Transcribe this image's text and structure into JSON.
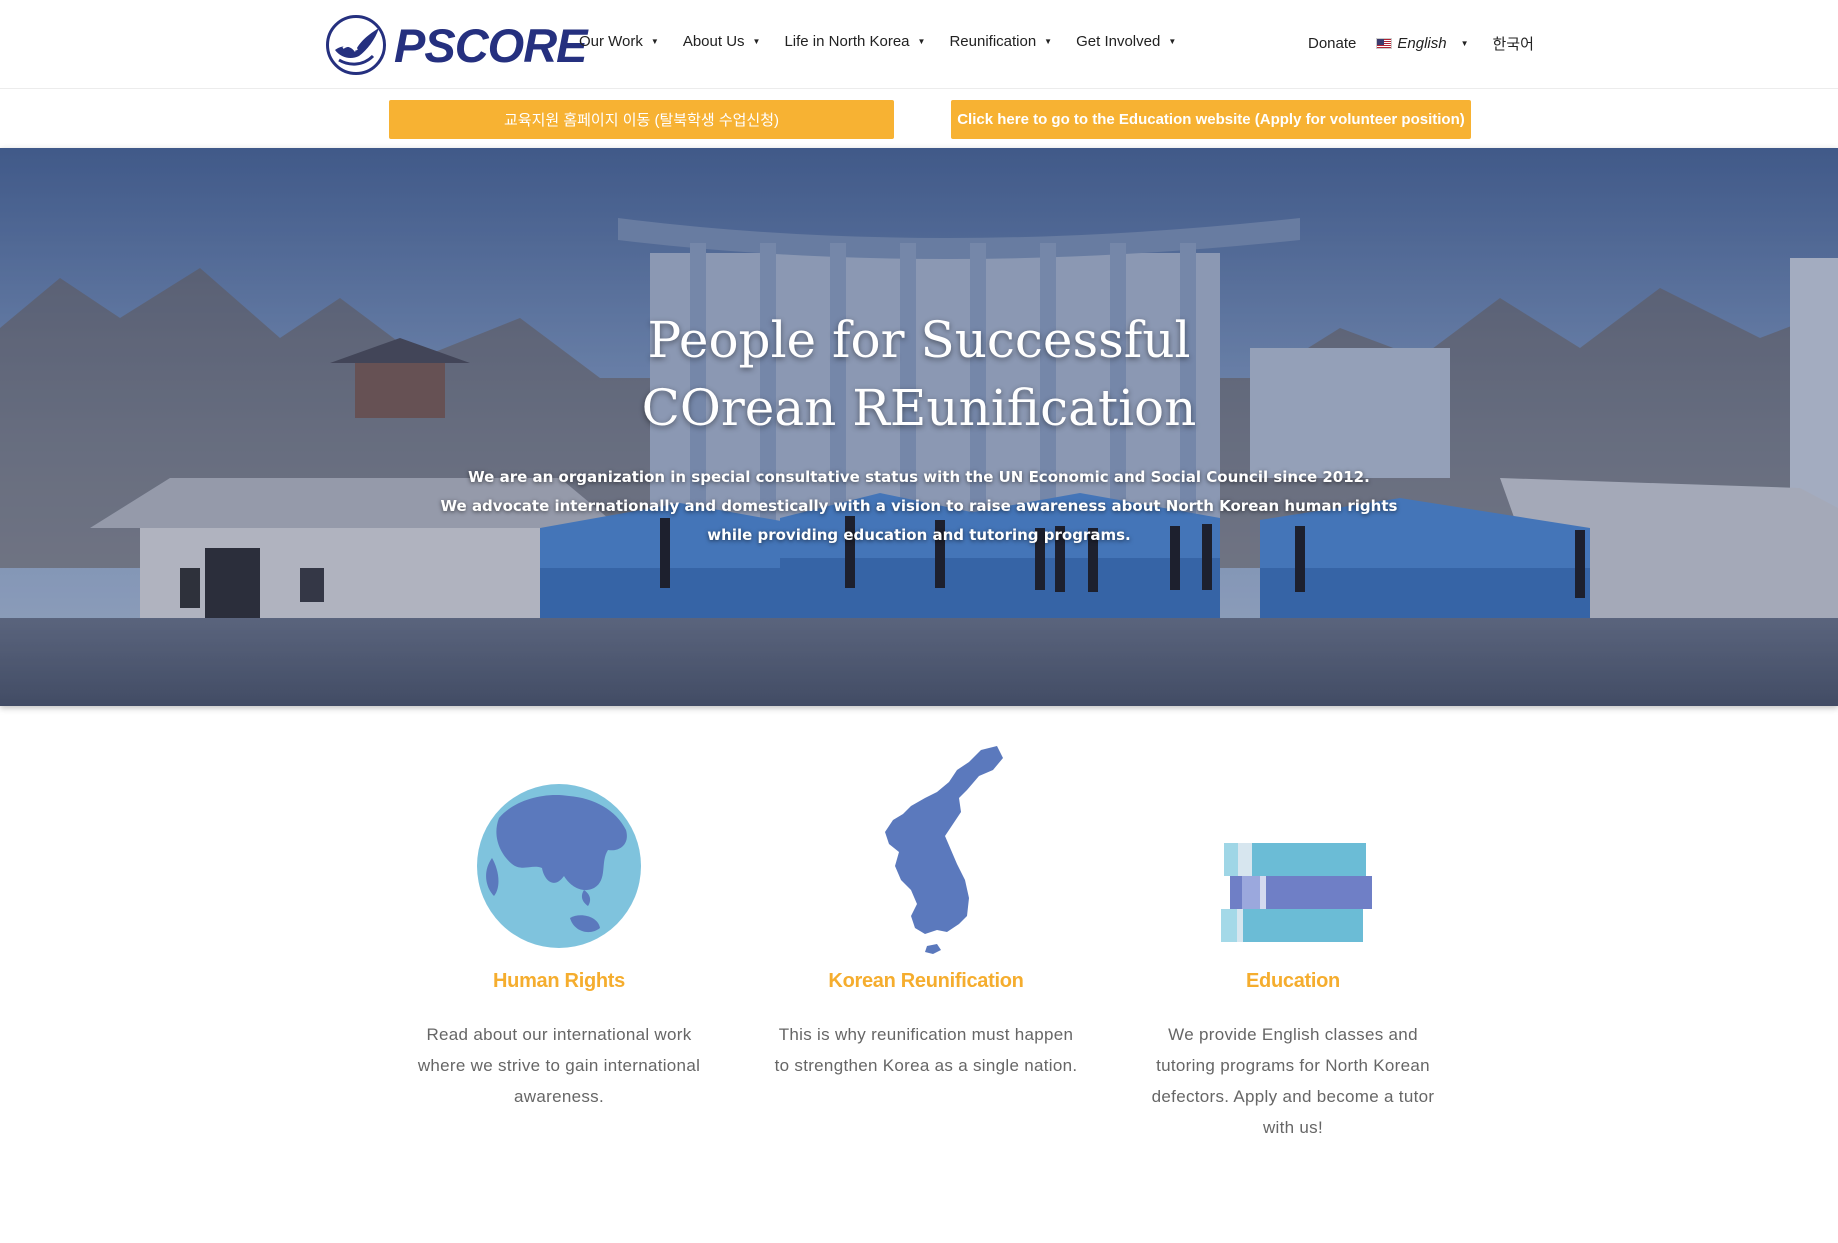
{
  "header": {
    "logo_text": "PSCORE",
    "nav": [
      {
        "label": "Our Work"
      },
      {
        "label": "About Us"
      },
      {
        "label": "Life in North Korea"
      },
      {
        "label": "Reunification"
      },
      {
        "label": "Get Involved"
      }
    ],
    "donate_label": "Donate",
    "language_label": "English",
    "korean_label": "한국어"
  },
  "banner": {
    "korean_button": "교육지원 홈페이지 이동 (탈북학생 수업신청)",
    "english_button": "Click here to go to the Education website (Apply for volunteer position)"
  },
  "hero": {
    "title_line1": "People for Successful",
    "title_line2": "COrean REunification",
    "sub_line1": "We are an organization in special consultative status with the UN Economic and Social Council since 2012.",
    "sub_line2": "We advocate internationally and domestically with a vision to raise awareness about North Korean human rights",
    "sub_line3": "while providing education and tutoring programs."
  },
  "features": [
    {
      "title": "Human Rights",
      "text": "Read about our international work where we strive to gain international awareness.",
      "icon": "globe-icon"
    },
    {
      "title": "Korean Reunification",
      "text": "This is why reunification must happen to strengthen Korea as a single nation.",
      "icon": "korea-map-icon"
    },
    {
      "title": "Education",
      "text": "We provide English classes and tutoring programs for North Korean defectors. Apply and become a tutor with us!",
      "icon": "books-icon"
    }
  ],
  "colors": {
    "accent": "#f7b233",
    "brand": "#25307f",
    "feature_title": "#f5ad2e",
    "icon_blue": "#5b79bd",
    "icon_light": "#7fc3dd"
  }
}
